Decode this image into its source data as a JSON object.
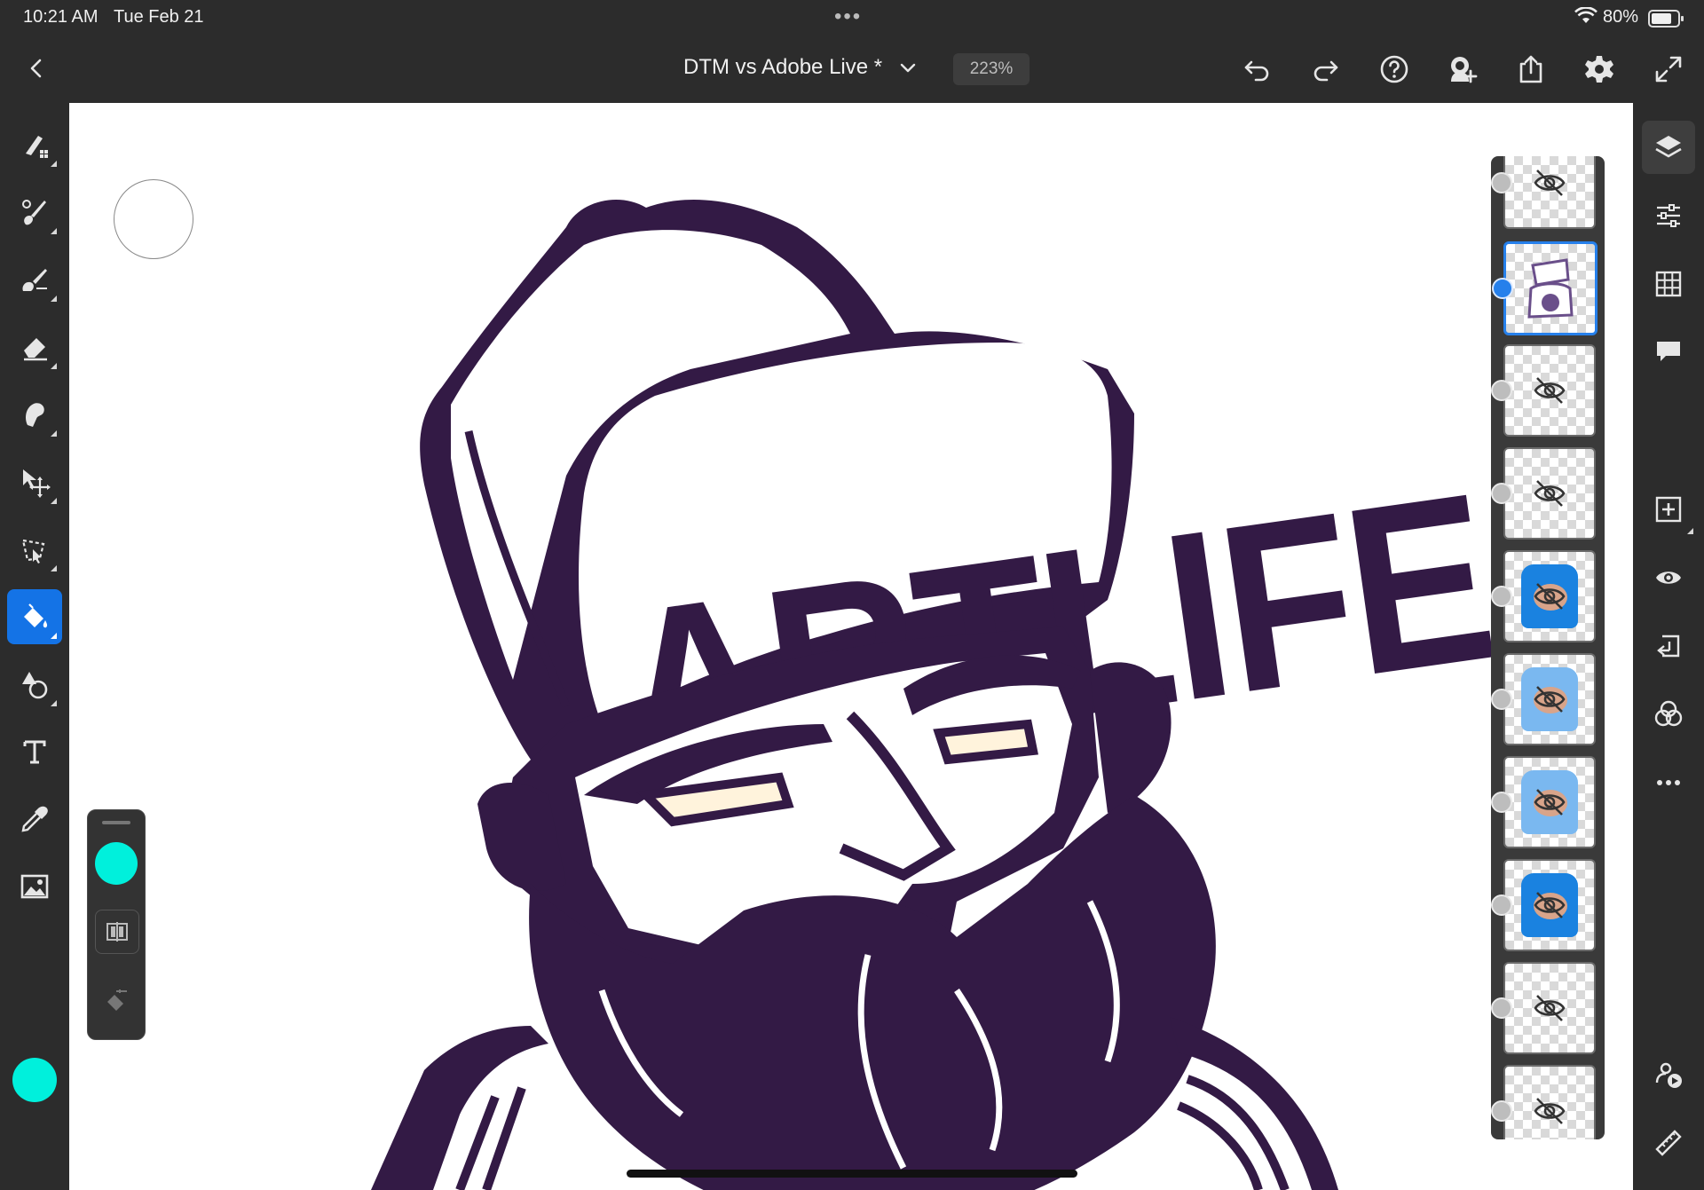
{
  "status_bar": {
    "time": "10:21 AM",
    "date": "Tue Feb 21",
    "more": "•••",
    "battery": "80%"
  },
  "toolbar": {
    "title": "DTM vs Adobe Live *",
    "zoom": "223%"
  },
  "artwork": {
    "cap_text": "ARTLIFE",
    "ink_color": "#331a45",
    "eye_color": "#fff3dc"
  },
  "colors": {
    "accent": "#1473e6",
    "current_color": "#00f0dc",
    "chrome": "#2c2c2c",
    "canvas": "#ffffff"
  },
  "left_tools": [
    "pixel-brush-icon",
    "paint-brush-icon",
    "mixer-brush-icon",
    "eraser-icon",
    "smudge-icon",
    "move-transform-icon",
    "lasso-select-icon",
    "fill-bucket-icon",
    "shape-icon",
    "text-icon",
    "eyedropper-icon",
    "image-icon"
  ],
  "right_tools": [
    "layers-icon",
    "properties-icon",
    "grid-icon",
    "comments-icon",
    "add-layer-icon",
    "visibility-icon",
    "merge-down-icon",
    "blend-mode-icon",
    "more-icon",
    "live-stream-icon",
    "ruler-icon"
  ]
}
